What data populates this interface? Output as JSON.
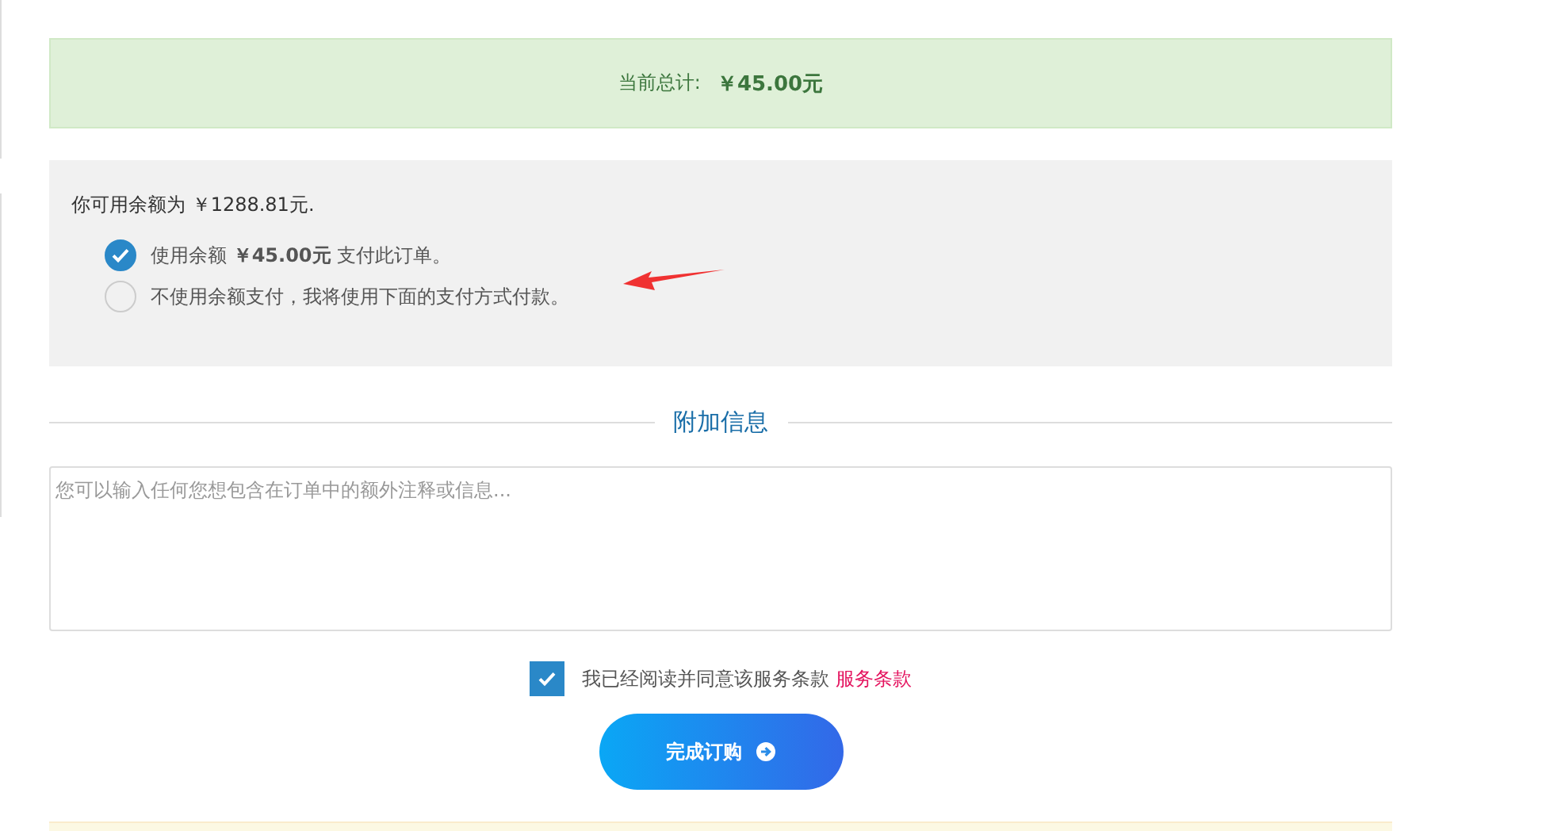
{
  "total": {
    "label": "当前总计:",
    "amount": "￥45.00元"
  },
  "balance": {
    "text": "你可用余额为 ￥1288.81元.",
    "options": [
      {
        "label": "使用余额 **￥45.00元** 支付此订单。",
        "selected": true
      },
      {
        "label": "不使用余额支付，我将使用下面的支付方式付款。",
        "selected": false
      }
    ]
  },
  "extra_info": {
    "title": "附加信息",
    "notes": {
      "placeholder": "您可以输入任何您想包含在订单中的额外注释或信息..."
    }
  },
  "terms": {
    "checked": true,
    "text": "我已经阅读并同意该服务条款",
    "link": "服务条款"
  },
  "submit": {
    "label": "完成订购"
  }
}
